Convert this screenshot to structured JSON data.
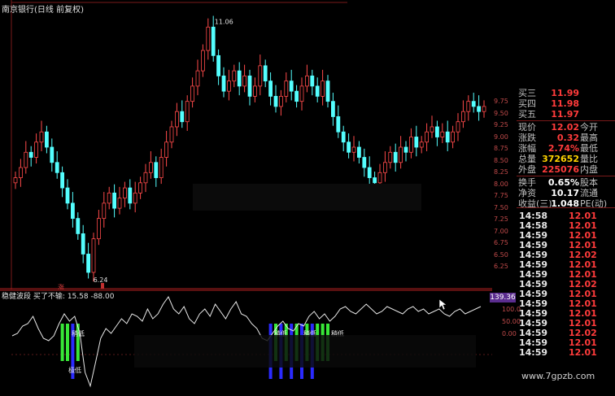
{
  "title": "南京银行(日线 前复权)",
  "indicator": {
    "name": "稳健波段",
    "sub": "买了不输:",
    "v1": "15.58",
    "v2": "-88.00",
    "badge": "139.36"
  },
  "annotations": {
    "high": "11.06",
    "low": "6.24",
    "limit_mark": "涨"
  },
  "signals": {
    "buy_low": "稍低",
    "extreme_low": "极低"
  },
  "ind_axis": [
    "100.0",
    "50.00",
    "0.00"
  ],
  "price_axis": [
    "9.75",
    "9.50",
    "9.25",
    "9.00",
    "8.75",
    "8.50",
    "8.25",
    "8.00",
    "7.75",
    "7.50",
    "7.25",
    "7.00",
    "6.75",
    "6.50",
    "6.25"
  ],
  "quote": {
    "rows": [
      {
        "label": "买三",
        "value": "11.99",
        "value_color": "#ff3b3b",
        "label2": ""
      },
      {
        "label": "买四",
        "value": "11.98",
        "value_color": "#ff3b3b",
        "label2": ""
      },
      {
        "label": "买五",
        "value": "11.97",
        "value_color": "#ff3b3b",
        "label2": ""
      },
      {
        "label": "现价",
        "value": "12.02",
        "value_color": "#ff3b3b",
        "label2": "今开"
      },
      {
        "label": "涨跌",
        "value": "0.32",
        "value_color": "#ff3b3b",
        "label2": "最高"
      },
      {
        "label": "涨幅",
        "value": "2.74%",
        "value_color": "#ff3b3b",
        "label2": "最低"
      },
      {
        "label": "总量",
        "value": "372652",
        "value_color": "#ffd400",
        "label2": "量比"
      },
      {
        "label": "外盘",
        "value": "225076",
        "value_color": "#ff3b3b",
        "label2": "内盘"
      },
      {
        "label": "换手",
        "value": "0.65%",
        "value_color": "#ffffff",
        "label2": "股本"
      },
      {
        "label": "净资",
        "value": "10.17",
        "value_color": "#ffffff",
        "label2": "流通"
      },
      {
        "label": "收益(三)",
        "value": "1.048",
        "value_color": "#ffffff",
        "label2": "PE(动)"
      }
    ],
    "ticks": [
      {
        "time": "14:58",
        "price": "12.01"
      },
      {
        "time": "14:58",
        "price": "12.01"
      },
      {
        "time": "14:59",
        "price": "12.01"
      },
      {
        "time": "14:59",
        "price": "12.01"
      },
      {
        "time": "14:59",
        "price": "12.02"
      },
      {
        "time": "14:59",
        "price": "12.01"
      },
      {
        "time": "14:59",
        "price": "12.01"
      },
      {
        "time": "14:59",
        "price": "12.02"
      },
      {
        "time": "14:59",
        "price": "12.01"
      },
      {
        "time": "14:59",
        "price": "12.01"
      },
      {
        "time": "14:59",
        "price": "12.01"
      },
      {
        "time": "14:59",
        "price": "12.01"
      },
      {
        "time": "14:59",
        "price": "12.02"
      },
      {
        "time": "14:59",
        "price": "12.01"
      },
      {
        "time": "14:59",
        "price": "12.01"
      }
    ]
  },
  "watermark": "www.7gpzb.com",
  "chart_data": {
    "type": "candlestick",
    "title": "南京银行(日线 前复权)",
    "annotations": [
      {
        "label": "11.06",
        "kind": "high"
      },
      {
        "label": "6.24",
        "kind": "low"
      }
    ],
    "closes": [
      8.1,
      8.3,
      8.6,
      8.5,
      8.8,
      9.0,
      8.7,
      8.4,
      8.2,
      7.9,
      7.6,
      7.3,
      7.0,
      6.6,
      6.24,
      6.9,
      7.3,
      7.6,
      7.8,
      7.5,
      7.7,
      7.9,
      7.6,
      7.8,
      8.0,
      8.2,
      8.4,
      8.1,
      8.5,
      8.8,
      9.1,
      9.4,
      9.2,
      9.6,
      9.9,
      10.2,
      10.6,
      11.06,
      10.5,
      10.1,
      9.8,
      10.0,
      10.2,
      9.9,
      10.1,
      9.7,
      9.9,
      10.3,
      10.0,
      9.7,
      9.5,
      9.7,
      10.0,
      9.8,
      9.6,
      9.9,
      10.1,
      9.9,
      9.7,
      10.0,
      9.6,
      9.3,
      9.0,
      8.8,
      8.6,
      8.7,
      8.5,
      8.3,
      8.1,
      8.0,
      8.2,
      8.4,
      8.6,
      8.4,
      8.7,
      8.6,
      8.9,
      8.7,
      8.8,
      9.0,
      9.1,
      8.9,
      9.0,
      8.8,
      9.0,
      9.2,
      9.4,
      9.6,
      9.5,
      9.4,
      9.5
    ],
    "indicator_series": {
      "name": "稳健波段",
      "values": [
        15,
        20,
        35,
        40,
        55,
        30,
        10,
        5,
        15,
        40,
        60,
        45,
        55,
        20,
        -60,
        -88,
        -40,
        10,
        30,
        20,
        35,
        50,
        40,
        60,
        55,
        45,
        70,
        50,
        60,
        80,
        95,
        70,
        60,
        75,
        50,
        40,
        60,
        70,
        55,
        80,
        65,
        50,
        70,
        85,
        60,
        55,
        40,
        30,
        10,
        5,
        20,
        35,
        45,
        30,
        25,
        40,
        35,
        55,
        65,
        50,
        60,
        45,
        55,
        70,
        75,
        65,
        60,
        70,
        80,
        70,
        60,
        65,
        75,
        70,
        65,
        60,
        70,
        75,
        65,
        70,
        60,
        65,
        70,
        60,
        55,
        65,
        70,
        60,
        65,
        70,
        75
      ]
    }
  }
}
